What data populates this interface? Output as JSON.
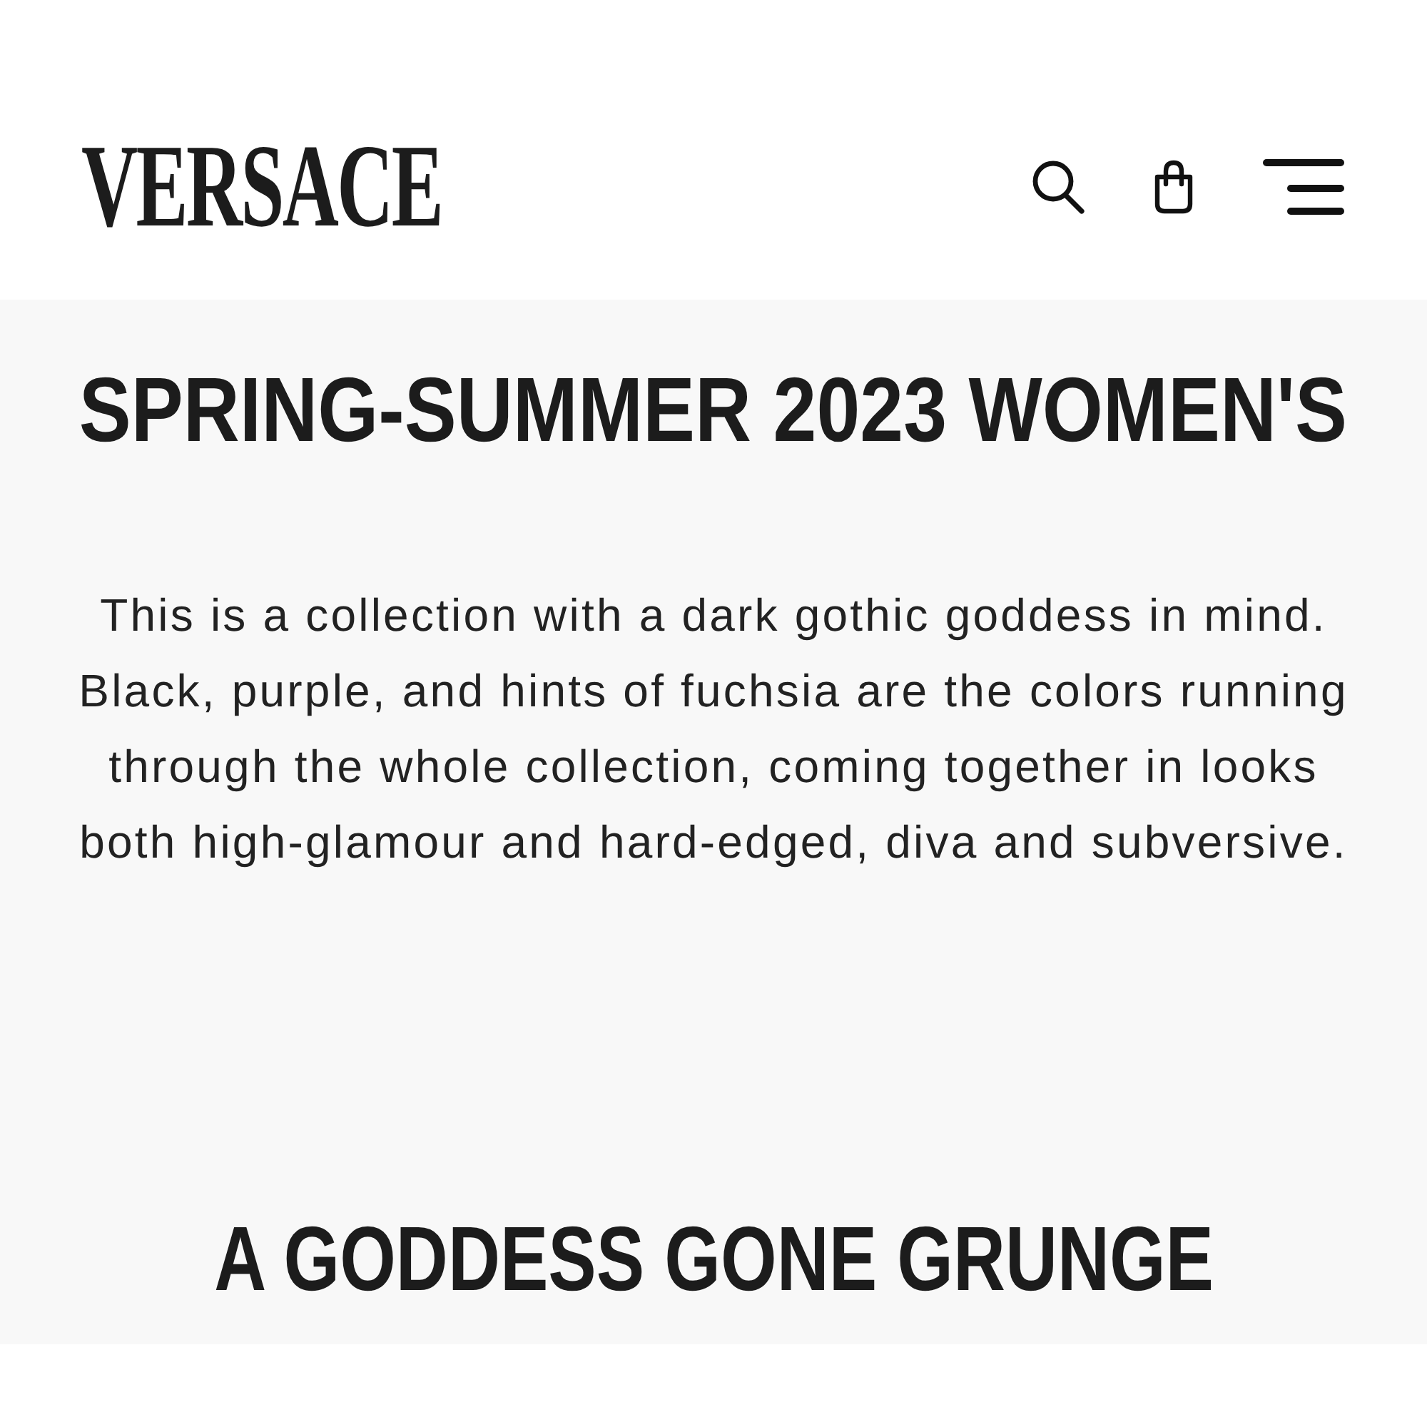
{
  "header": {
    "logo": "VERSACE"
  },
  "collection": {
    "title": "SPRING-SUMMER 2023 WOMEN'S",
    "description": "This is a collection with a dark gothic goddess in mind. Black, purple, and hints of fuchsia are the colors running through the whole collection, coming together in looks both high-glamour and hard-edged, diva and subversive."
  },
  "section": {
    "title": "A GODDESS GONE GRUNGE"
  }
}
